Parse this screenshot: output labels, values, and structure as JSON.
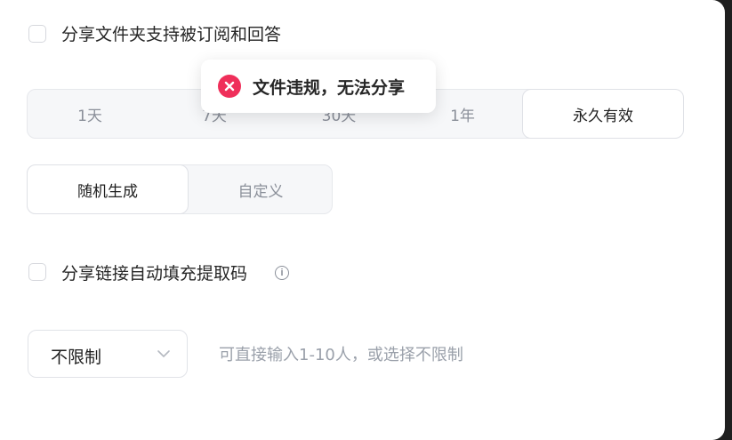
{
  "subscribe_option": {
    "label": "分享文件夹支持被订阅和回答",
    "checked": false
  },
  "toast": {
    "message": "文件违规，无法分享",
    "icon": "error-circle-icon",
    "color": "#ef2f5a"
  },
  "validity": {
    "options": [
      "1天",
      "7天",
      "30天",
      "1年",
      "永久有效"
    ],
    "selected": "永久有效"
  },
  "code_mode": {
    "options": [
      "随机生成",
      "自定义"
    ],
    "selected": "随机生成"
  },
  "autofill_option": {
    "label": "分享链接自动填充提取码",
    "checked": false,
    "info_icon": "info-icon"
  },
  "limit": {
    "selected_value": "不限制",
    "hint": "可直接输入1-10人，或选择不限制"
  }
}
